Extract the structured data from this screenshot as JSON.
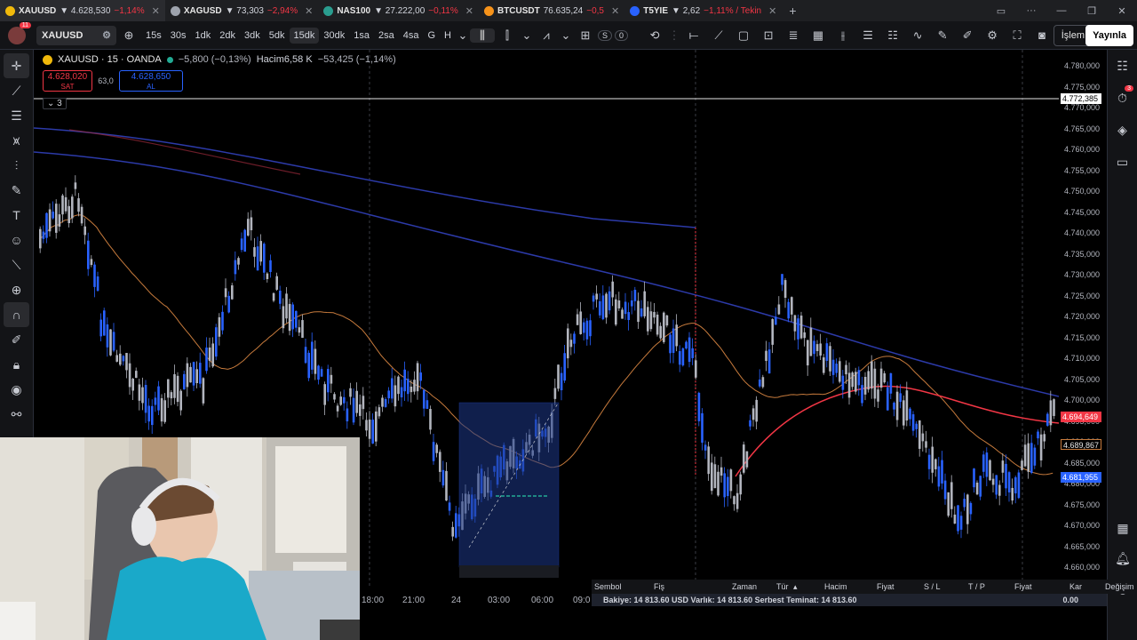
{
  "browser": {
    "tabs": [
      {
        "symbol": "XAUUSD",
        "price": "▼ 4.628,530",
        "change": "−1,14%",
        "color": "#f0b90b"
      },
      {
        "symbol": "XAGUSD",
        "price": "▼ 73,303",
        "change": "−2,94%",
        "color": "#9ea3ad"
      },
      {
        "symbol": "NAS100",
        "price": "▼ 27.222,00",
        "change": "−0,11%",
        "color": "#2a9d8f"
      },
      {
        "symbol": "BTCUSDT",
        "price": "76.635,24",
        "change": "−0,5",
        "color": "#f7931a"
      },
      {
        "symbol": "T5YIE",
        "price": "▼ 2,62",
        "change": "−1,11% / Tekin",
        "color": "#2962ff"
      }
    ],
    "new_tab": "+"
  },
  "toolbar": {
    "avatar_badge": "11",
    "symbol": "XAUUSD",
    "intervals": [
      "15s",
      "30s",
      "1dk",
      "2dk",
      "3dk",
      "5dk",
      "15dk",
      "30dk",
      "1sa",
      "2sa",
      "4sa",
      "G",
      "H"
    ],
    "active_interval": "15dk",
    "counter_s": "S",
    "counter_0": "0",
    "trade_button": "İşlem",
    "publish_button": "Yayınla"
  },
  "legend": {
    "title": "XAUUSD · 15 · OANDA",
    "change": "−5,800 (−0,13%)",
    "volume_label": "Hacim",
    "volume_value": "6,58 K",
    "volume_change": "−53,425 (−1,14%)",
    "sell_price": "4.628,020",
    "sell_label": "SAT",
    "spread": "63,0",
    "buy_price": "4.628,650",
    "buy_label": "AL",
    "collapse_count": "3"
  },
  "price_axis": {
    "labels": [
      "4.780,000",
      "4.775,000",
      "4.770,000",
      "4.765,000",
      "4.760,000",
      "4.755,000",
      "4.750,000",
      "4.745,000",
      "4.740,000",
      "4.735,000",
      "4.730,000",
      "4.725,000",
      "4.720,000",
      "4.715,000",
      "4.710,000",
      "4.705,000",
      "4.700,000",
      "4.695,000",
      "4.690,000",
      "4.685,000",
      "4.680,000",
      "4.675,000",
      "4.670,000",
      "4.665,000",
      "4.660,000"
    ],
    "tag_hline": "4.772,385",
    "tag_red": "4.694,649",
    "tag_orange": "4.689,867",
    "tag_blue": "4.681,955"
  },
  "time_axis": {
    "labels": [
      "18:00",
      "21:00",
      "24",
      "03:00",
      "06:00",
      "09:0"
    ]
  },
  "panel": {
    "columns": [
      "Sembol",
      "Fiş",
      "Zaman",
      "Tür",
      "Hacim",
      "Fiyat",
      "S / L",
      "T / P",
      "Fiyat",
      "Kar",
      "Değişim"
    ],
    "account_text": "Bakiye: 14 813.60 USD  Varlık: 14 813.60  Serbest Teminat: 14 813.60",
    "profit": "0.00"
  },
  "colors": {
    "bull": "#2962ff",
    "bear": "#b2b5be",
    "ma_red": "#f23645",
    "ma_orange": "#c67a3c",
    "ma_blue": "#2c3aa8"
  }
}
